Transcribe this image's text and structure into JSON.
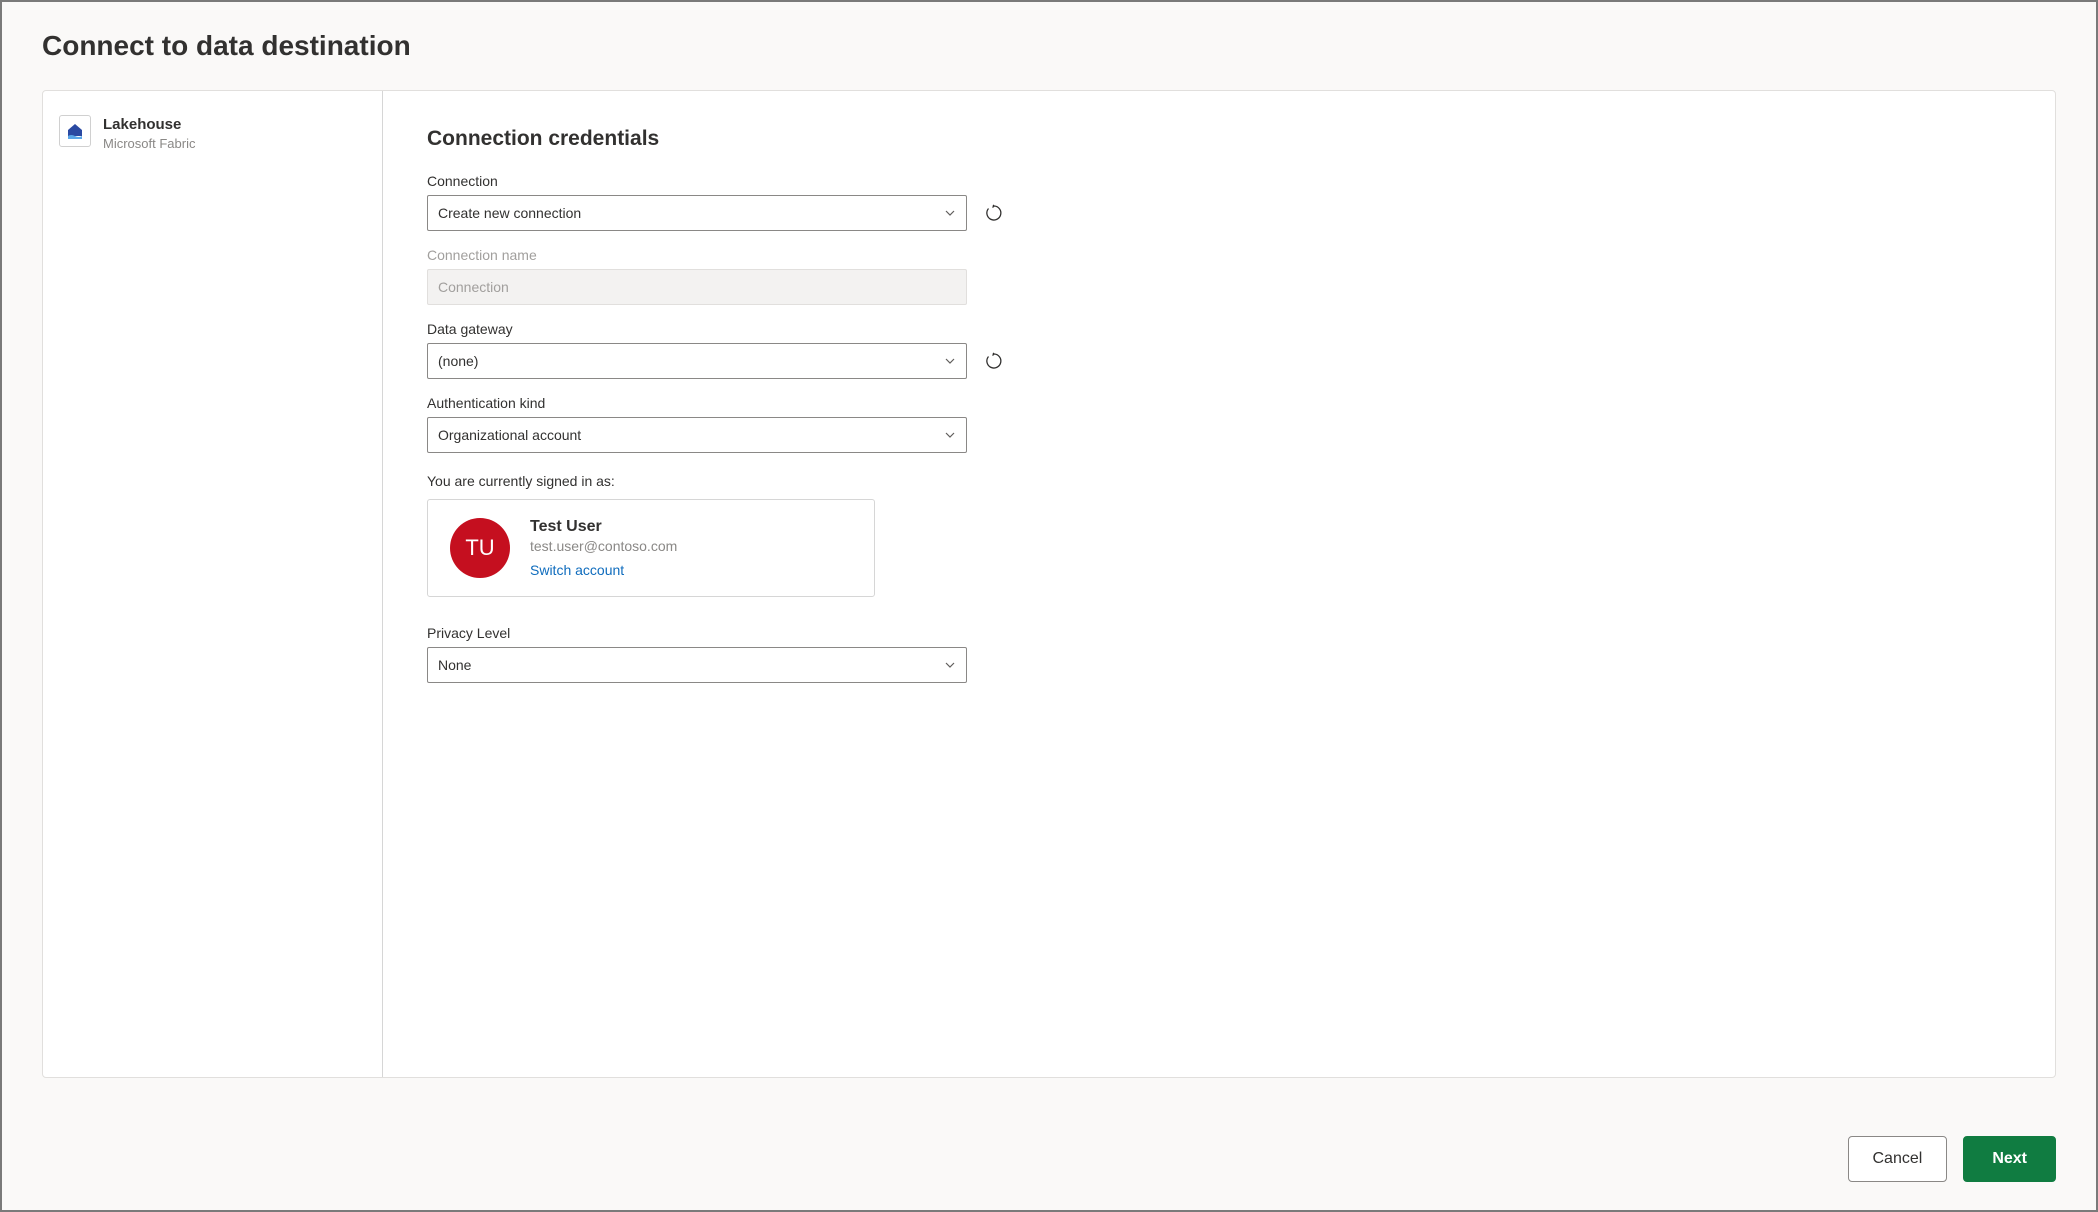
{
  "dialog": {
    "title": "Connect to data destination"
  },
  "sidebar": {
    "item": {
      "label": "Lakehouse",
      "sublabel": "Microsoft Fabric"
    }
  },
  "form": {
    "section_title": "Connection credentials",
    "connection": {
      "label": "Connection",
      "value": "Create new connection"
    },
    "connection_name": {
      "label": "Connection name",
      "value": "Connection"
    },
    "data_gateway": {
      "label": "Data gateway",
      "value": "(none)"
    },
    "auth_kind": {
      "label": "Authentication kind",
      "value": "Organizational account"
    },
    "signed_in_as_label": "You are currently signed in as:",
    "account": {
      "initials": "TU",
      "name": "Test User",
      "email": "test.user@contoso.com",
      "switch_label": "Switch account"
    },
    "privacy": {
      "label": "Privacy Level",
      "value": "None"
    }
  },
  "footer": {
    "cancel": "Cancel",
    "next": "Next"
  }
}
